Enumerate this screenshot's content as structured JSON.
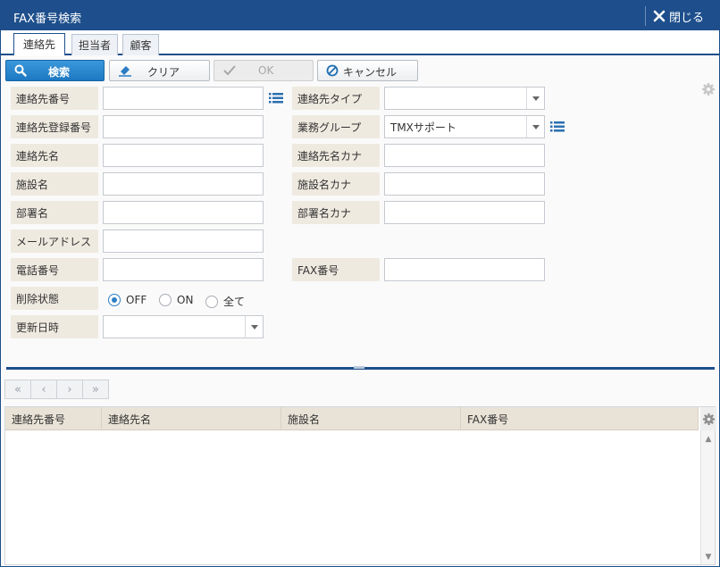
{
  "window": {
    "title": "FAX番号検索",
    "close_label": "閉じる"
  },
  "tabs": [
    {
      "label": "連絡先",
      "active": true
    },
    {
      "label": "担当者",
      "active": false
    },
    {
      "label": "顧客",
      "active": false
    }
  ],
  "toolbar": {
    "search_label": "検索",
    "clear_label": "クリア",
    "ok_label": "OK",
    "cancel_label": "キャンセル"
  },
  "form": {
    "contact_no_label": "連絡先番号",
    "contact_no_value": "",
    "contact_reg_no_label": "連絡先登録番号",
    "contact_reg_no_value": "",
    "contact_name_label": "連絡先名",
    "contact_name_value": "",
    "facility_name_label": "施設名",
    "facility_name_value": "",
    "department_label": "部署名",
    "department_value": "",
    "email_label": "メールアドレス",
    "email_value": "",
    "phone_label": "電話番号",
    "phone_value": "",
    "delete_status_label": "削除状態",
    "delete_options": [
      "OFF",
      "ON",
      "全て"
    ],
    "delete_selected": "OFF",
    "updated_label": "更新日時",
    "updated_value": "",
    "contact_type_label": "連絡先タイプ",
    "contact_type_value": "",
    "business_group_label": "業務グループ",
    "business_group_value": "TMXサポート",
    "contact_kana_label": "連絡先名カナ",
    "contact_kana_value": "",
    "facility_kana_label": "施設名カナ",
    "facility_kana_value": "",
    "department_kana_label": "部署名カナ",
    "department_kana_value": "",
    "fax_label": "FAX番号",
    "fax_value": ""
  },
  "pager": {
    "first": "«",
    "prev": "‹",
    "next": "›",
    "last": "»"
  },
  "grid": {
    "columns": [
      "連絡先番号",
      "連絡先名",
      "施設名",
      "FAX番号"
    ],
    "rows": []
  },
  "colors": {
    "title_bar": "#1e4f8c",
    "primary_button": "#1d78c2",
    "label_bg": "#efeae0"
  },
  "icons": {
    "search": "search-icon",
    "clear": "eraser-icon",
    "ok": "check-icon",
    "cancel": "cancel-icon",
    "close": "close-icon",
    "list": "list-icon",
    "gear": "gear-icon"
  }
}
